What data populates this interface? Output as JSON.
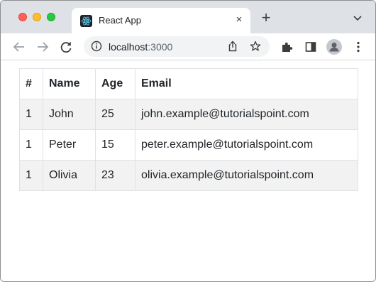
{
  "window": {
    "tab": {
      "title": "React App",
      "close": "×"
    },
    "new_tab": "+"
  },
  "toolbar": {
    "url_host": "localhost",
    "url_port": ":3000"
  },
  "table": {
    "headers": [
      "#",
      "Name",
      "Age",
      "Email"
    ],
    "rows": [
      [
        "1",
        "John",
        "25",
        "john.example@tutorialspoint.com"
      ],
      [
        "1",
        "Peter",
        "15",
        "peter.example@tutorialspoint.com"
      ],
      [
        "1",
        "Olivia",
        "23",
        "olivia.example@tutorialspoint.com"
      ]
    ]
  },
  "colors": {
    "tabstrip": "#dee1e6",
    "stripe": "#f2f2f2",
    "border": "#dee2e6"
  },
  "icons": {
    "traffic": [
      "close-window-icon",
      "minimize-window-icon",
      "zoom-window-icon"
    ],
    "favicon": "react-logo-icon",
    "toolbar": [
      "back-arrow-icon",
      "forward-arrow-icon",
      "reload-icon",
      "info-icon",
      "share-icon",
      "star-icon",
      "extensions-puzzle-icon",
      "side-panel-icon",
      "profile-avatar-icon",
      "more-vertical-icon"
    ]
  }
}
